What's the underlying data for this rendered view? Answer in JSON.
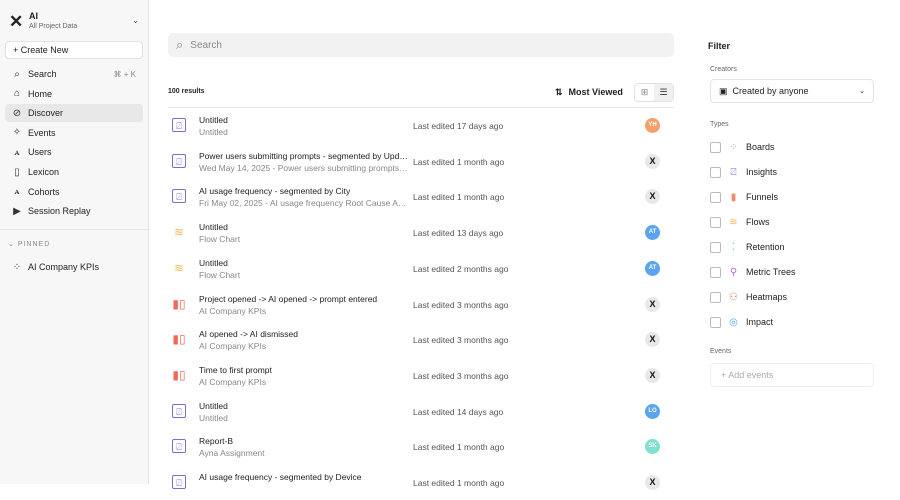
{
  "sidebar": {
    "project_name": "AI",
    "project_sub": "All Project Data",
    "create_label": "Create New",
    "nav": [
      {
        "label": "Search",
        "icon": "search-icon",
        "glyph": "⌕",
        "shortcut": "⌘ + K"
      },
      {
        "label": "Home",
        "icon": "home-icon",
        "glyph": "⌂"
      },
      {
        "label": "Discover",
        "icon": "compass-icon",
        "glyph": "⊘",
        "active": true
      },
      {
        "label": "Events",
        "icon": "events-icon",
        "glyph": "✧"
      },
      {
        "label": "Users",
        "icon": "users-icon",
        "glyph": "ꭺ"
      },
      {
        "label": "Lexicon",
        "icon": "book-icon",
        "glyph": "▯"
      },
      {
        "label": "Cohorts",
        "icon": "cohorts-icon",
        "glyph": "ꭺ"
      },
      {
        "label": "Session Replay",
        "icon": "replay-icon",
        "glyph": "▶"
      }
    ],
    "pinned_label": "PINNED",
    "pinned": [
      {
        "label": "AI Company KPIs",
        "icon": "board-icon",
        "glyph": "⁘"
      }
    ]
  },
  "main": {
    "search_placeholder": "Search",
    "results_count": "100 results",
    "sort_label": "Most Viewed",
    "rows": [
      {
        "title": "Untitled",
        "subtitle": "Untitled",
        "edited": "Last edited 17 days ago",
        "type": "insight",
        "avatar": "YH",
        "avatar_color": "#f4a06b"
      },
      {
        "title": "Power users submitting prompts - segmented by Updat...",
        "subtitle": "Wed May 14, 2025 - Power users submitting prompts Ro...",
        "edited": "Last edited 1 month ago",
        "type": "insight",
        "avatar": "X",
        "avatar_color": "#e8e8e8"
      },
      {
        "title": "AI usage frequency - segmented by City",
        "subtitle": "Fri May 02, 2025 - AI usage frequency Root Cause Analy...",
        "edited": "Last edited 1 month ago",
        "type": "insight",
        "avatar": "X",
        "avatar_color": "#e8e8e8"
      },
      {
        "title": "Untitled",
        "subtitle": "Flow Chart",
        "edited": "Last edited 13 days ago",
        "type": "flow",
        "avatar": "AT",
        "avatar_color": "#5aa5ee"
      },
      {
        "title": "Untitled",
        "subtitle": "Flow Chart",
        "edited": "Last edited 2 months ago",
        "type": "flow",
        "avatar": "AT",
        "avatar_color": "#5aa5ee"
      },
      {
        "title": "Project opened -> AI opened -> prompt entered",
        "subtitle": "AI Company KPIs",
        "edited": "Last edited 3 months ago",
        "type": "funnel",
        "avatar": "X",
        "avatar_color": "#e8e8e8"
      },
      {
        "title": "AI opened -> AI dismissed",
        "subtitle": "AI Company KPIs",
        "edited": "Last edited 3 months ago",
        "type": "funnel",
        "avatar": "X",
        "avatar_color": "#e8e8e8"
      },
      {
        "title": "Time to first prompt",
        "subtitle": "AI Company KPIs",
        "edited": "Last edited 3 months ago",
        "type": "funnel",
        "avatar": "X",
        "avatar_color": "#e8e8e8"
      },
      {
        "title": "Untitled",
        "subtitle": "Untitled",
        "edited": "Last edited 14 days ago",
        "type": "insight",
        "avatar": "LO",
        "avatar_color": "#5aa5ee"
      },
      {
        "title": "Report-B",
        "subtitle": "Ayna Assignment",
        "edited": "Last edited 1 month ago",
        "type": "insight",
        "avatar": "SK",
        "avatar_color": "#7fe0cf"
      },
      {
        "title": "AI usage frequency - segmented by Device",
        "subtitle": "",
        "edited": "Last edited 1 month ago",
        "type": "insight",
        "avatar": "X",
        "avatar_color": "#e8e8e8"
      }
    ]
  },
  "filter": {
    "title": "Filter",
    "creators_label": "Creators",
    "creator_value": "Created by anyone",
    "types_label": "Types",
    "types": [
      {
        "label": "Boards",
        "glyph": "⁘",
        "color": "#e58a9a"
      },
      {
        "label": "Insights",
        "glyph": "⍁",
        "color": "#7c6bd6"
      },
      {
        "label": "Funnels",
        "glyph": "▮",
        "color": "#f08a6a"
      },
      {
        "label": "Flows",
        "glyph": "≋",
        "color": "#f3b94c"
      },
      {
        "label": "Retention",
        "glyph": "⁚",
        "color": "#5fc7d8"
      },
      {
        "label": "Metric Trees",
        "glyph": "⚲",
        "color": "#b06bd6"
      },
      {
        "label": "Heatmaps",
        "glyph": "⚇",
        "color": "#ee7a6a"
      },
      {
        "label": "Impact",
        "glyph": "◎",
        "color": "#5aa5ee"
      }
    ],
    "events_label": "Events",
    "add_events": "+ Add events"
  },
  "type_icons": {
    "insight": {
      "glyph": "⍁",
      "color": "#7c6bd6"
    },
    "flow": {
      "glyph": "≋",
      "color": "#f3b94c"
    },
    "funnel": {
      "glyph": "▮▯",
      "color": "#ee6a5a"
    }
  }
}
